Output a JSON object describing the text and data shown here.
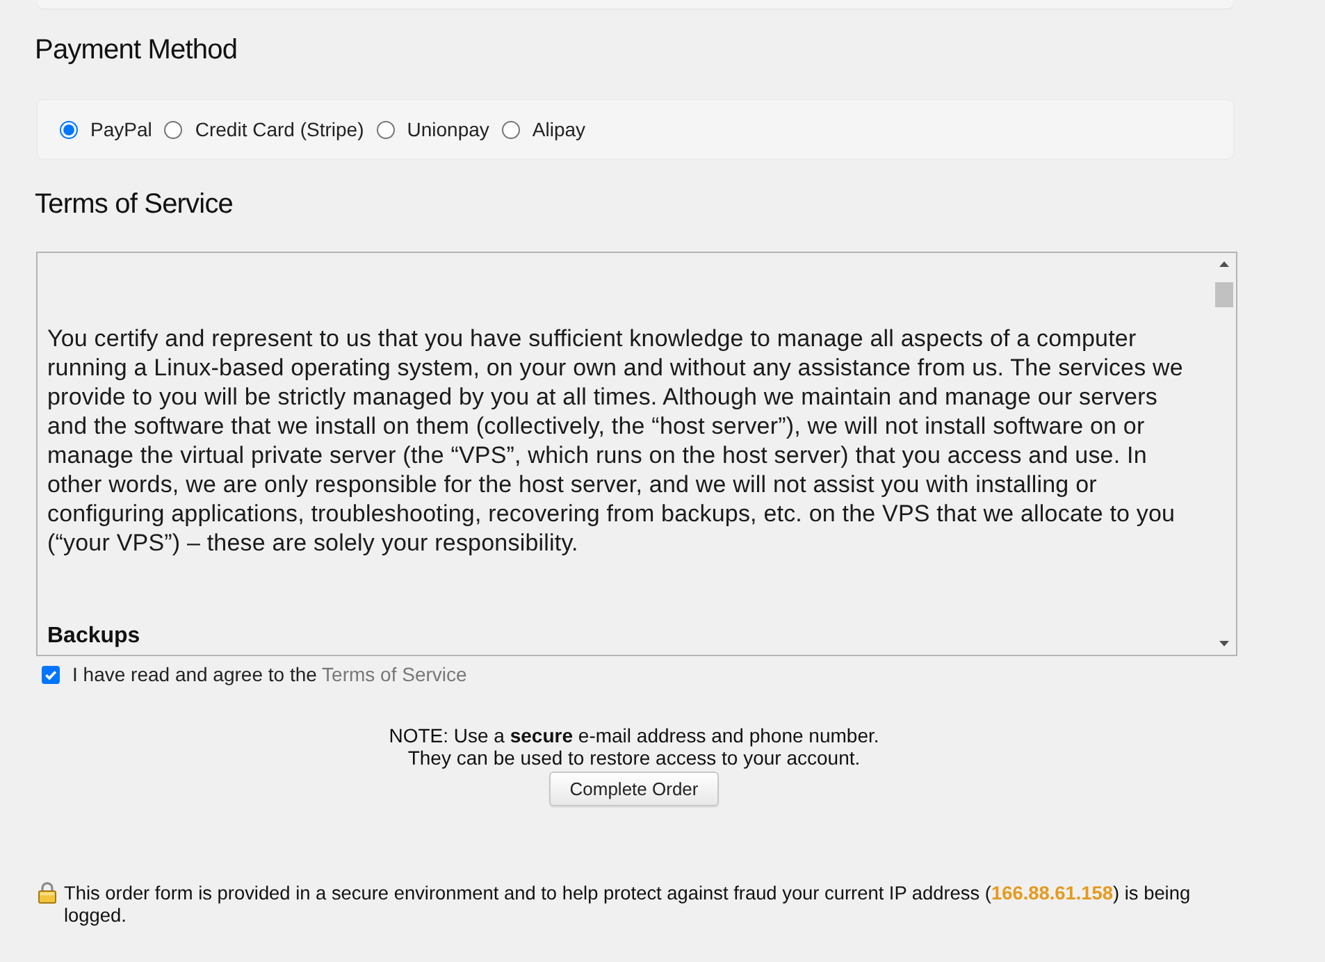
{
  "payment": {
    "heading": "Payment Method",
    "methods": [
      {
        "label": "PayPal",
        "selected": true
      },
      {
        "label": "Credit Card (Stripe)",
        "selected": false
      },
      {
        "label": "Unionpay",
        "selected": false
      },
      {
        "label": "Alipay",
        "selected": false
      }
    ]
  },
  "terms": {
    "heading": "Terms of Service",
    "blocks": [
      {
        "kind": "text",
        "text": "You certify and represent to us that you have sufficient knowledge to manage all aspects of a computer running a Linux-based operating system, on your own and without any assistance from us. The services we provide to you will be strictly managed by you at all times. Although we maintain and manage our servers and the software that we install on them (collectively, the “host server”), we will not install software on or manage the virtual private server (the “VPS”, which runs on the host server) that you access and use. In other words, we are only responsible for the host server, and we will not assist you with installing or configuring applications, troubleshooting, recovering from backups, etc. on the VPS that we allocate to you (“your VPS”) – these are solely your responsibility."
      },
      {
        "kind": "heading",
        "text": "Backups"
      }
    ]
  },
  "agreement": {
    "checked": true,
    "label": "I have read and agree to the",
    "link": "Terms of Service"
  },
  "note": {
    "lines": [
      "NOTE: Use a **secure** e-mail address and phone number.",
      "They can be used to restore access to your account."
    ]
  },
  "submit": {
    "label": "Complete Order"
  },
  "footer": {
    "text": "This order form is provided in a secure environment and to help protect against fraud your current IP address (**166.88.61.158**) is being logged."
  }
}
